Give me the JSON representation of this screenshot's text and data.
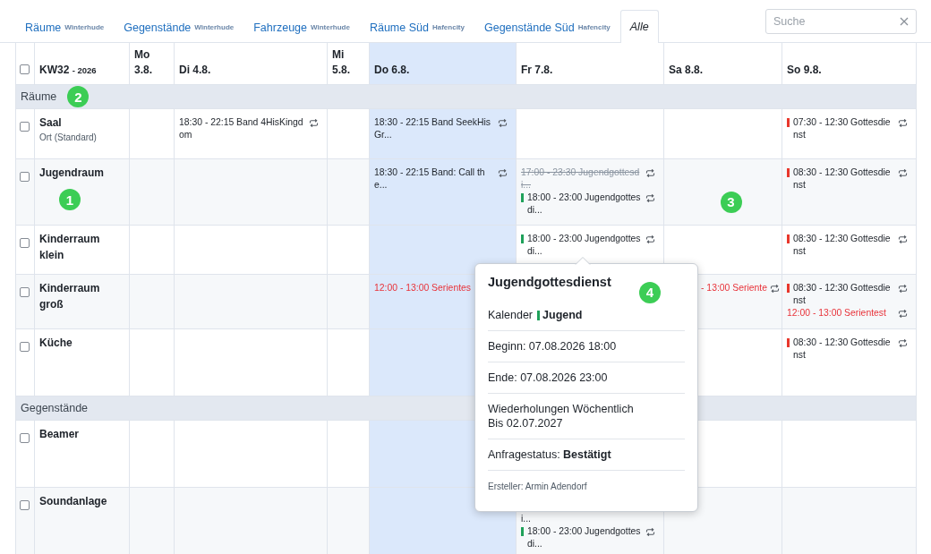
{
  "tabs": [
    {
      "label": "Räume",
      "location": "Winterhude",
      "selected": false
    },
    {
      "label": "Gegenstände",
      "location": "Winterhude",
      "selected": false
    },
    {
      "label": "Fahrzeuge",
      "location": "Winterhude",
      "selected": false
    },
    {
      "label": "Räume Süd",
      "location": "Hafencity",
      "selected": false
    },
    {
      "label": "Gegenstände Süd",
      "location": "Hafencity",
      "selected": false
    },
    {
      "label": "Alle",
      "selected": true
    }
  ],
  "search": {
    "placeholder": "Suche"
  },
  "calendar": {
    "select_all": {
      "checked": false
    },
    "week": "KW32",
    "year": "- 2026",
    "days": [
      {
        "label": "Mo 3.8.",
        "today": false
      },
      {
        "label": "Di 4.8.",
        "today": false
      },
      {
        "label": "Mi 5.8.",
        "today": false
      },
      {
        "label": "Do 6.8.",
        "today": true
      },
      {
        "label": "Fr 7.8.",
        "today": false
      },
      {
        "label": "Sa 8.8.",
        "today": false
      },
      {
        "label": "So 9.8.",
        "today": false
      }
    ],
    "sections": [
      {
        "title": "Räume",
        "marker": "2",
        "rows": [
          {
            "name": "Saal",
            "subtitle": "Ort (Standard)",
            "checked": false,
            "cells": [
              {},
              {
                "events": [
                  {
                    "kind": "normal",
                    "text": "18:30 - 22:15 Band 4HisKingdom",
                    "repeat": true
                  }
                ]
              },
              {},
              {
                "events": [
                  {
                    "kind": "normal",
                    "text": "18:30 - 22:15 Band SeekHisGr...",
                    "repeat": true
                  }
                ]
              },
              {},
              {},
              {
                "events": [
                  {
                    "kind": "normal",
                    "color": "#e8372c",
                    "text": "07:30 - 12:30 Gottesdienst",
                    "repeat": true
                  }
                ]
              }
            ]
          },
          {
            "name": "Jugendraum",
            "checked": false,
            "marker": "1",
            "cells": [
              {},
              {},
              {},
              {
                "events": [
                  {
                    "kind": "normal",
                    "text": "18:30 - 22:15 Band: Call the...",
                    "repeat": true
                  }
                ]
              },
              {
                "events": [
                  {
                    "kind": "struck",
                    "text": "17:00 - 23:30 Jugendgottesdi...",
                    "repeat": true
                  },
                  {
                    "kind": "normal",
                    "color": "#1fa15a",
                    "text": "18:00 - 23:00 Jugendgottesdi...",
                    "repeat": true
                  }
                ]
              },
              {
                "marker": "3"
              },
              {
                "events": [
                  {
                    "kind": "normal",
                    "color": "#e8372c",
                    "text": "08:30 - 12:30 Gottesdienst",
                    "repeat": true
                  }
                ]
              }
            ]
          },
          {
            "name": "Kinderraum klein",
            "checked": false,
            "cells": [
              {},
              {},
              {},
              {},
              {
                "events": [
                  {
                    "kind": "normal",
                    "color": "#1fa15a",
                    "text": "18:00 - 23:00 Jugendgottesdi...",
                    "repeat": true
                  }
                ]
              },
              {},
              {
                "events": [
                  {
                    "kind": "normal",
                    "color": "#e8372c",
                    "text": "08:30 - 12:30 Gottesdienst",
                    "repeat": true
                  }
                ]
              }
            ]
          },
          {
            "name": "Kinderraum groß",
            "checked": false,
            "cells": [
              {},
              {},
              {},
              {
                "events": [
                  {
                    "kind": "series",
                    "text": "12:00 - 13:00 Serientes"
                  }
                ]
              },
              {},
              {
                "events": [
                  {
                    "kind": "series",
                    "text": "- 13:00 Seriente",
                    "repeat": true
                  }
                ]
              },
              {
                "events": [
                  {
                    "kind": "normal",
                    "color": "#e8372c",
                    "text": "08:30 - 12:30 Gottesdienst",
                    "repeat": true
                  },
                  {
                    "kind": "series",
                    "text": "12:00 - 13:00 Serientest",
                    "repeat": true
                  }
                ]
              }
            ]
          },
          {
            "name": "Küche",
            "checked": false,
            "cells": [
              {},
              {},
              {},
              {},
              {},
              {},
              {
                "events": [
                  {
                    "kind": "normal",
                    "color": "#e8372c",
                    "text": "08:30 - 12:30 Gottesdienst",
                    "repeat": true
                  }
                ]
              }
            ]
          }
        ]
      },
      {
        "title": "Gegenstände",
        "rows": [
          {
            "name": "Beamer",
            "checked": false,
            "cells": [
              {},
              {},
              {},
              {},
              {},
              {},
              {}
            ]
          },
          {
            "name": "Soundanlage",
            "checked": false,
            "cells": [
              {},
              {},
              {},
              {},
              {
                "events": [
                  {
                    "kind": "normal",
                    "text": "i..."
                  },
                  {
                    "kind": "normal",
                    "color": "#1fa15a",
                    "text": "18:00 - 23:00 Jugendgottesdi...",
                    "repeat": true
                  }
                ]
              },
              {},
              {}
            ]
          }
        ]
      }
    ]
  },
  "popover": {
    "title": "Jugendgottesdienst",
    "marker": "4",
    "calendar_label": "Kalender",
    "calendar": "Jugend",
    "color": "#1fa15a",
    "begin": "Beginn: 07.08.2026 18:00",
    "end": "Ende: 07.08.2026 23:00",
    "recurrence": [
      "Wiederholungen Wöchentlich",
      "Bis 02.07.2027"
    ],
    "status": "Anfragestatus: **Bestätigt**",
    "creator": "Ersteller: Armin Adendorf"
  }
}
